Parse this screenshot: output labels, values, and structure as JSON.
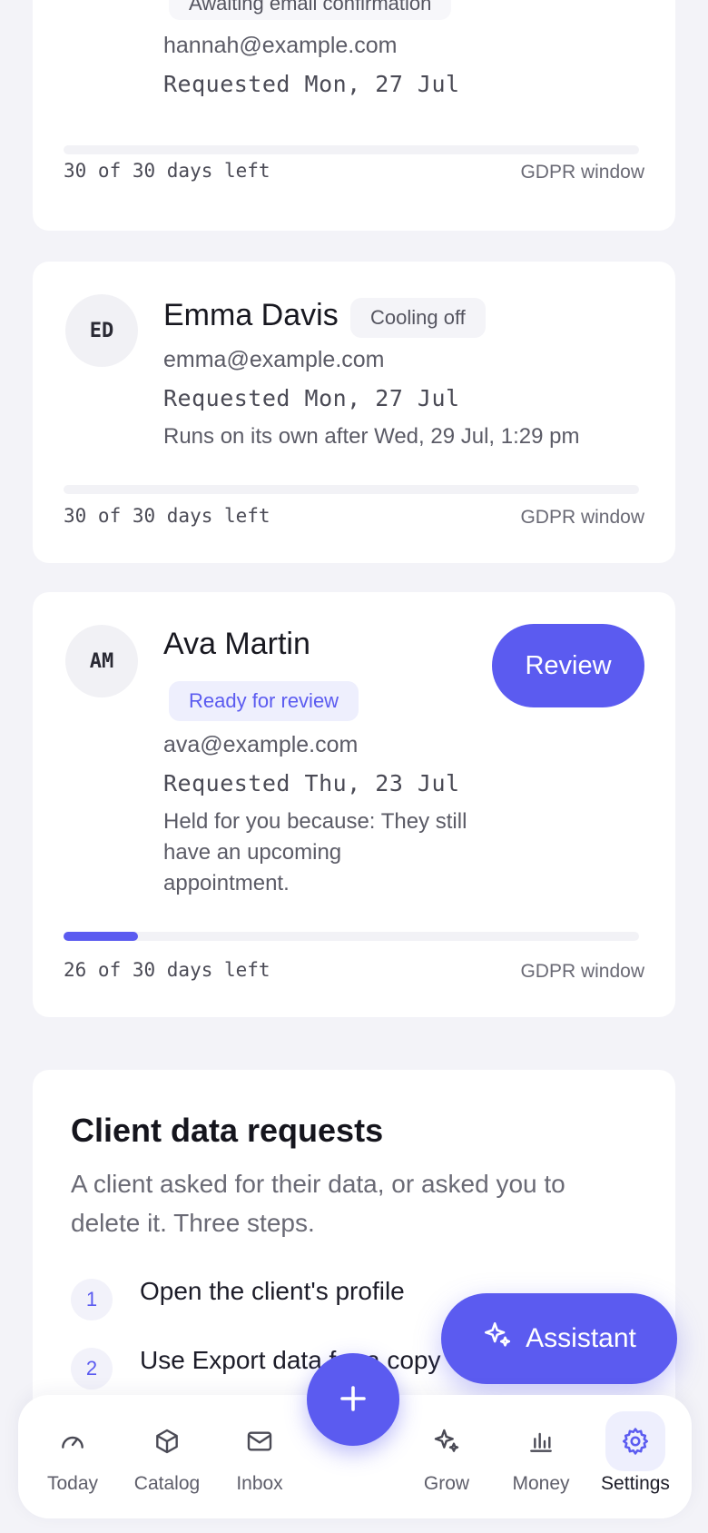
{
  "requests": [
    {
      "status": "Awaiting email confirmation",
      "email": "hannah@example.com",
      "requested": "Requested Mon, 27 Jul",
      "days_left": "30 of 30 days left",
      "window_label": "GDPR window",
      "progress": 0.0
    },
    {
      "initials": "ED",
      "name": "Emma Davis",
      "status": "Cooling off",
      "email": "emma@example.com",
      "requested": "Requested Mon, 27 Jul",
      "note": "Runs on its own after Wed, 29 Jul, 1:29 pm",
      "days_left": "30 of 30 days left",
      "window_label": "GDPR window",
      "progress": 0.0
    },
    {
      "initials": "AM",
      "name": "Ava Martin",
      "status": "Ready for review",
      "email": "ava@example.com",
      "requested": "Requested Thu, 23 Jul",
      "note": "Held for you because: They still have an upcoming appointment.",
      "action": "Review",
      "days_left": "26 of 30 days left",
      "window_label": "GDPR window",
      "progress": 0.13
    }
  ],
  "info": {
    "title": "Client data requests",
    "description": "A client asked for their data, or asked you to delete it. Three steps.",
    "steps": [
      {
        "num": "1",
        "text": "Open the client's profile"
      },
      {
        "num": "2",
        "text": "Use Export data for a copy"
      }
    ]
  },
  "assistant": {
    "label": "Assistant",
    "icon": "sparkle-icon"
  },
  "fab": {
    "icon": "plus-icon"
  },
  "nav": [
    {
      "label": "Today",
      "icon": "gauge-icon"
    },
    {
      "label": "Catalog",
      "icon": "box-icon"
    },
    {
      "label": "Inbox",
      "icon": "mail-icon"
    },
    {
      "label": "Grow",
      "icon": "sparkle-icon"
    },
    {
      "label": "Money",
      "icon": "bar-chart-icon"
    },
    {
      "label": "Settings",
      "icon": "gear-icon",
      "active": true
    }
  ],
  "colors": {
    "accent": "#5b5bf0",
    "background": "#f3f3f8"
  }
}
